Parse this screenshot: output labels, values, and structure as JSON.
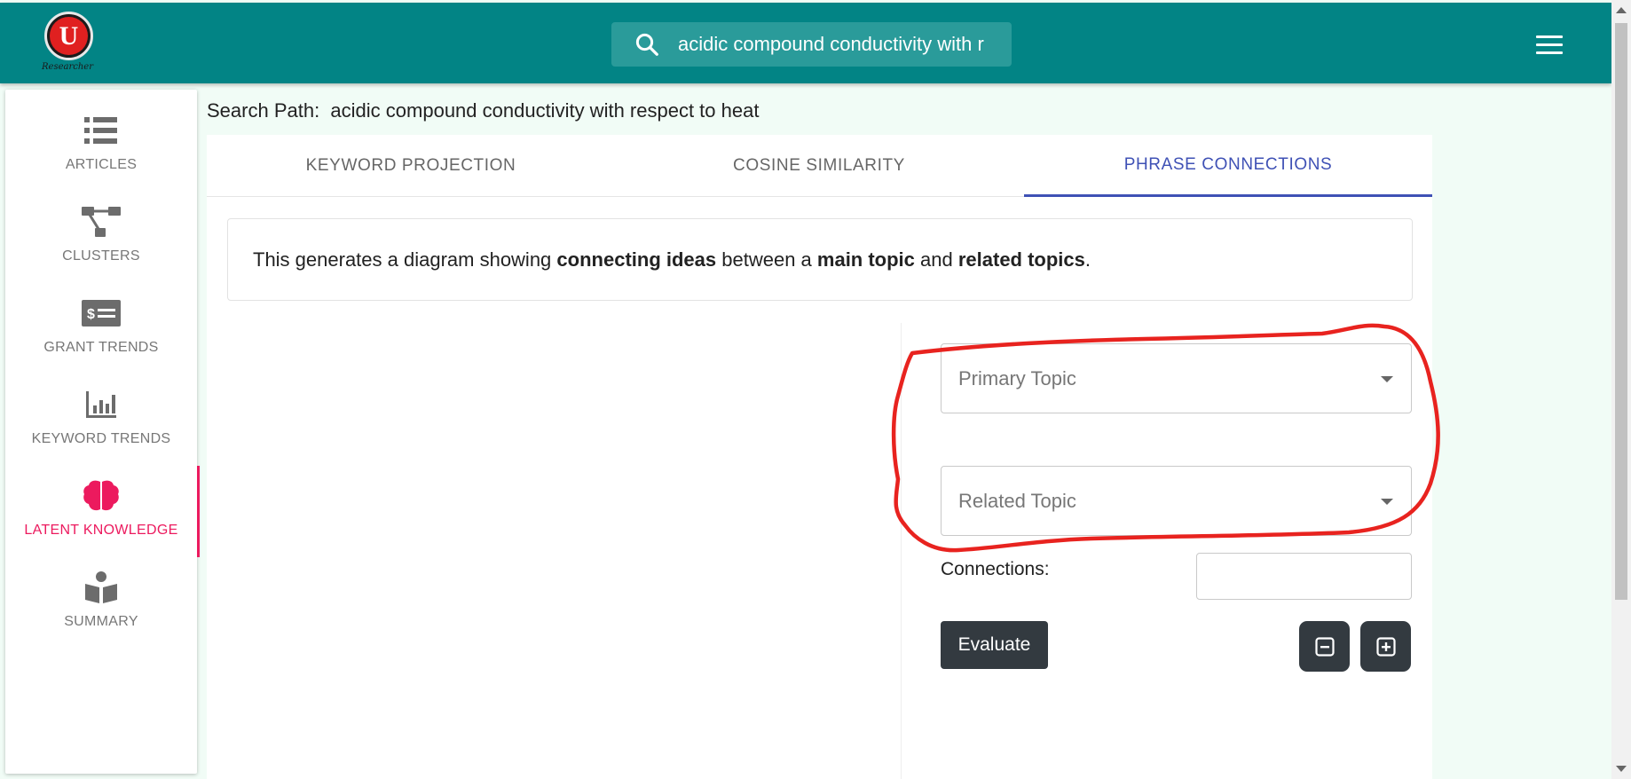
{
  "app": {
    "logo_letter": "U",
    "logo_text": "Researcher"
  },
  "search": {
    "value": "acidic compound conductivity with r",
    "icon": "search-icon"
  },
  "header": {
    "menu_icon": "hamburger-menu-icon"
  },
  "sidebar": {
    "items": [
      {
        "label": "ARTICLES",
        "icon": "list-icon",
        "active": false
      },
      {
        "label": "CLUSTERS",
        "icon": "cluster-tree-icon",
        "active": false
      },
      {
        "label": "GRANT TRENDS",
        "icon": "dollar-bill-icon",
        "active": false
      },
      {
        "label": "KEYWORD TRENDS",
        "icon": "bar-chart-icon",
        "active": false
      },
      {
        "label": "LATENT KNOWLEDGE",
        "icon": "brain-icon",
        "active": true
      },
      {
        "label": "SUMMARY",
        "icon": "reader-icon",
        "active": false
      }
    ],
    "active_color": "#ec1a5e"
  },
  "main": {
    "search_path_label": "Search Path:",
    "search_path_value": "acidic compound conductivity with respect to heat",
    "tabs": [
      {
        "label": "KEYWORD PROJECTION",
        "active": false
      },
      {
        "label": "COSINE SIMILARITY",
        "active": false
      },
      {
        "label": "PHRASE CONNECTIONS",
        "active": true
      }
    ],
    "info": {
      "p1": "This generates a diagram showing ",
      "b1": "connecting ideas",
      "p2": " between a ",
      "b2": "main topic",
      "p3": " and ",
      "b3": "related topics",
      "p4": "."
    },
    "form": {
      "primary_placeholder": "Primary Topic",
      "related_placeholder": "Related Topic",
      "connections_label": "Connections:",
      "connections_value": "",
      "evaluate_label": "Evaluate",
      "zoom_out_icon": "minus-square-icon",
      "zoom_in_icon": "plus-square-icon"
    }
  },
  "colors": {
    "header": "#028485",
    "tab_active": "#3f51b5",
    "annotation": "#e8231f",
    "button_dark": "#333a40"
  }
}
